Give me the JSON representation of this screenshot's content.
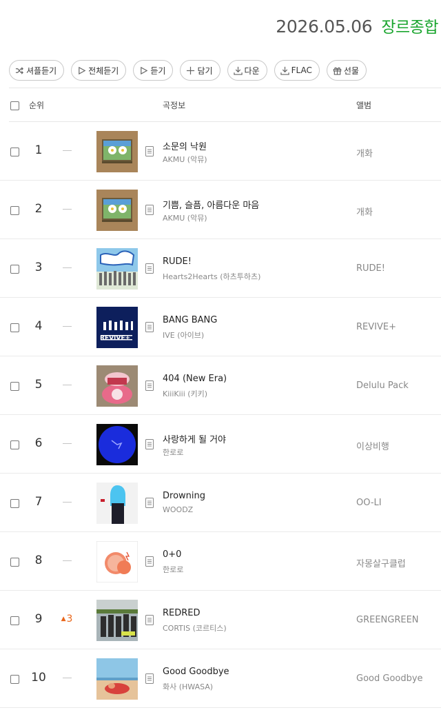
{
  "header": {
    "date": "2026.05.06",
    "genre": "장르종합"
  },
  "toolbar": [
    {
      "label": "셔플듣기",
      "icon": "shuffle-icon"
    },
    {
      "label": "전체듣기",
      "icon": "play-icon"
    },
    {
      "label": "듣기",
      "icon": "play-icon"
    },
    {
      "label": "담기",
      "icon": "plus-icon"
    },
    {
      "label": "다운",
      "icon": "download-icon"
    },
    {
      "label": "FLAC",
      "icon": "download-icon"
    },
    {
      "label": "선물",
      "icon": "gift-icon"
    }
  ],
  "table": {
    "col_rank": "순위",
    "col_info": "곡정보",
    "col_album": "앨범"
  },
  "songs": [
    {
      "rank": "1",
      "change": "",
      "title": "소문의 낙원",
      "artist": "AKMU (악뮤)",
      "album": "개화"
    },
    {
      "rank": "2",
      "change": "",
      "title": "기쁨, 슬픔, 아름다운 마음",
      "artist": "AKMU (악뮤)",
      "album": "개화"
    },
    {
      "rank": "3",
      "change": "",
      "title": "RUDE!",
      "artist": "Hearts2Hearts (하츠투하츠)",
      "album": "RUDE!"
    },
    {
      "rank": "4",
      "change": "",
      "title": "BANG BANG",
      "artist": "IVE (아이브)",
      "album": "REVIVE+"
    },
    {
      "rank": "5",
      "change": "",
      "title": "404 (New Era)",
      "artist": "KiiiKiii (키키)",
      "album": "Delulu Pack"
    },
    {
      "rank": "6",
      "change": "",
      "title": "사랑하게 될 거야",
      "artist": "한로로",
      "album": "이상비행"
    },
    {
      "rank": "7",
      "change": "",
      "title": "Drowning",
      "artist": "WOODZ",
      "album": "OO-LI"
    },
    {
      "rank": "8",
      "change": "",
      "title": "0+0",
      "artist": "한로로",
      "album": "자몽살구클럽"
    },
    {
      "rank": "9",
      "change": "3",
      "title": "REDRED",
      "artist": "CORTIS (코르티스)",
      "album": "GREENGREEN"
    },
    {
      "rank": "10",
      "change": "",
      "title": "Good Goodbye",
      "artist": "화사 (HWASA)",
      "album": "Good Goodbye"
    }
  ]
}
